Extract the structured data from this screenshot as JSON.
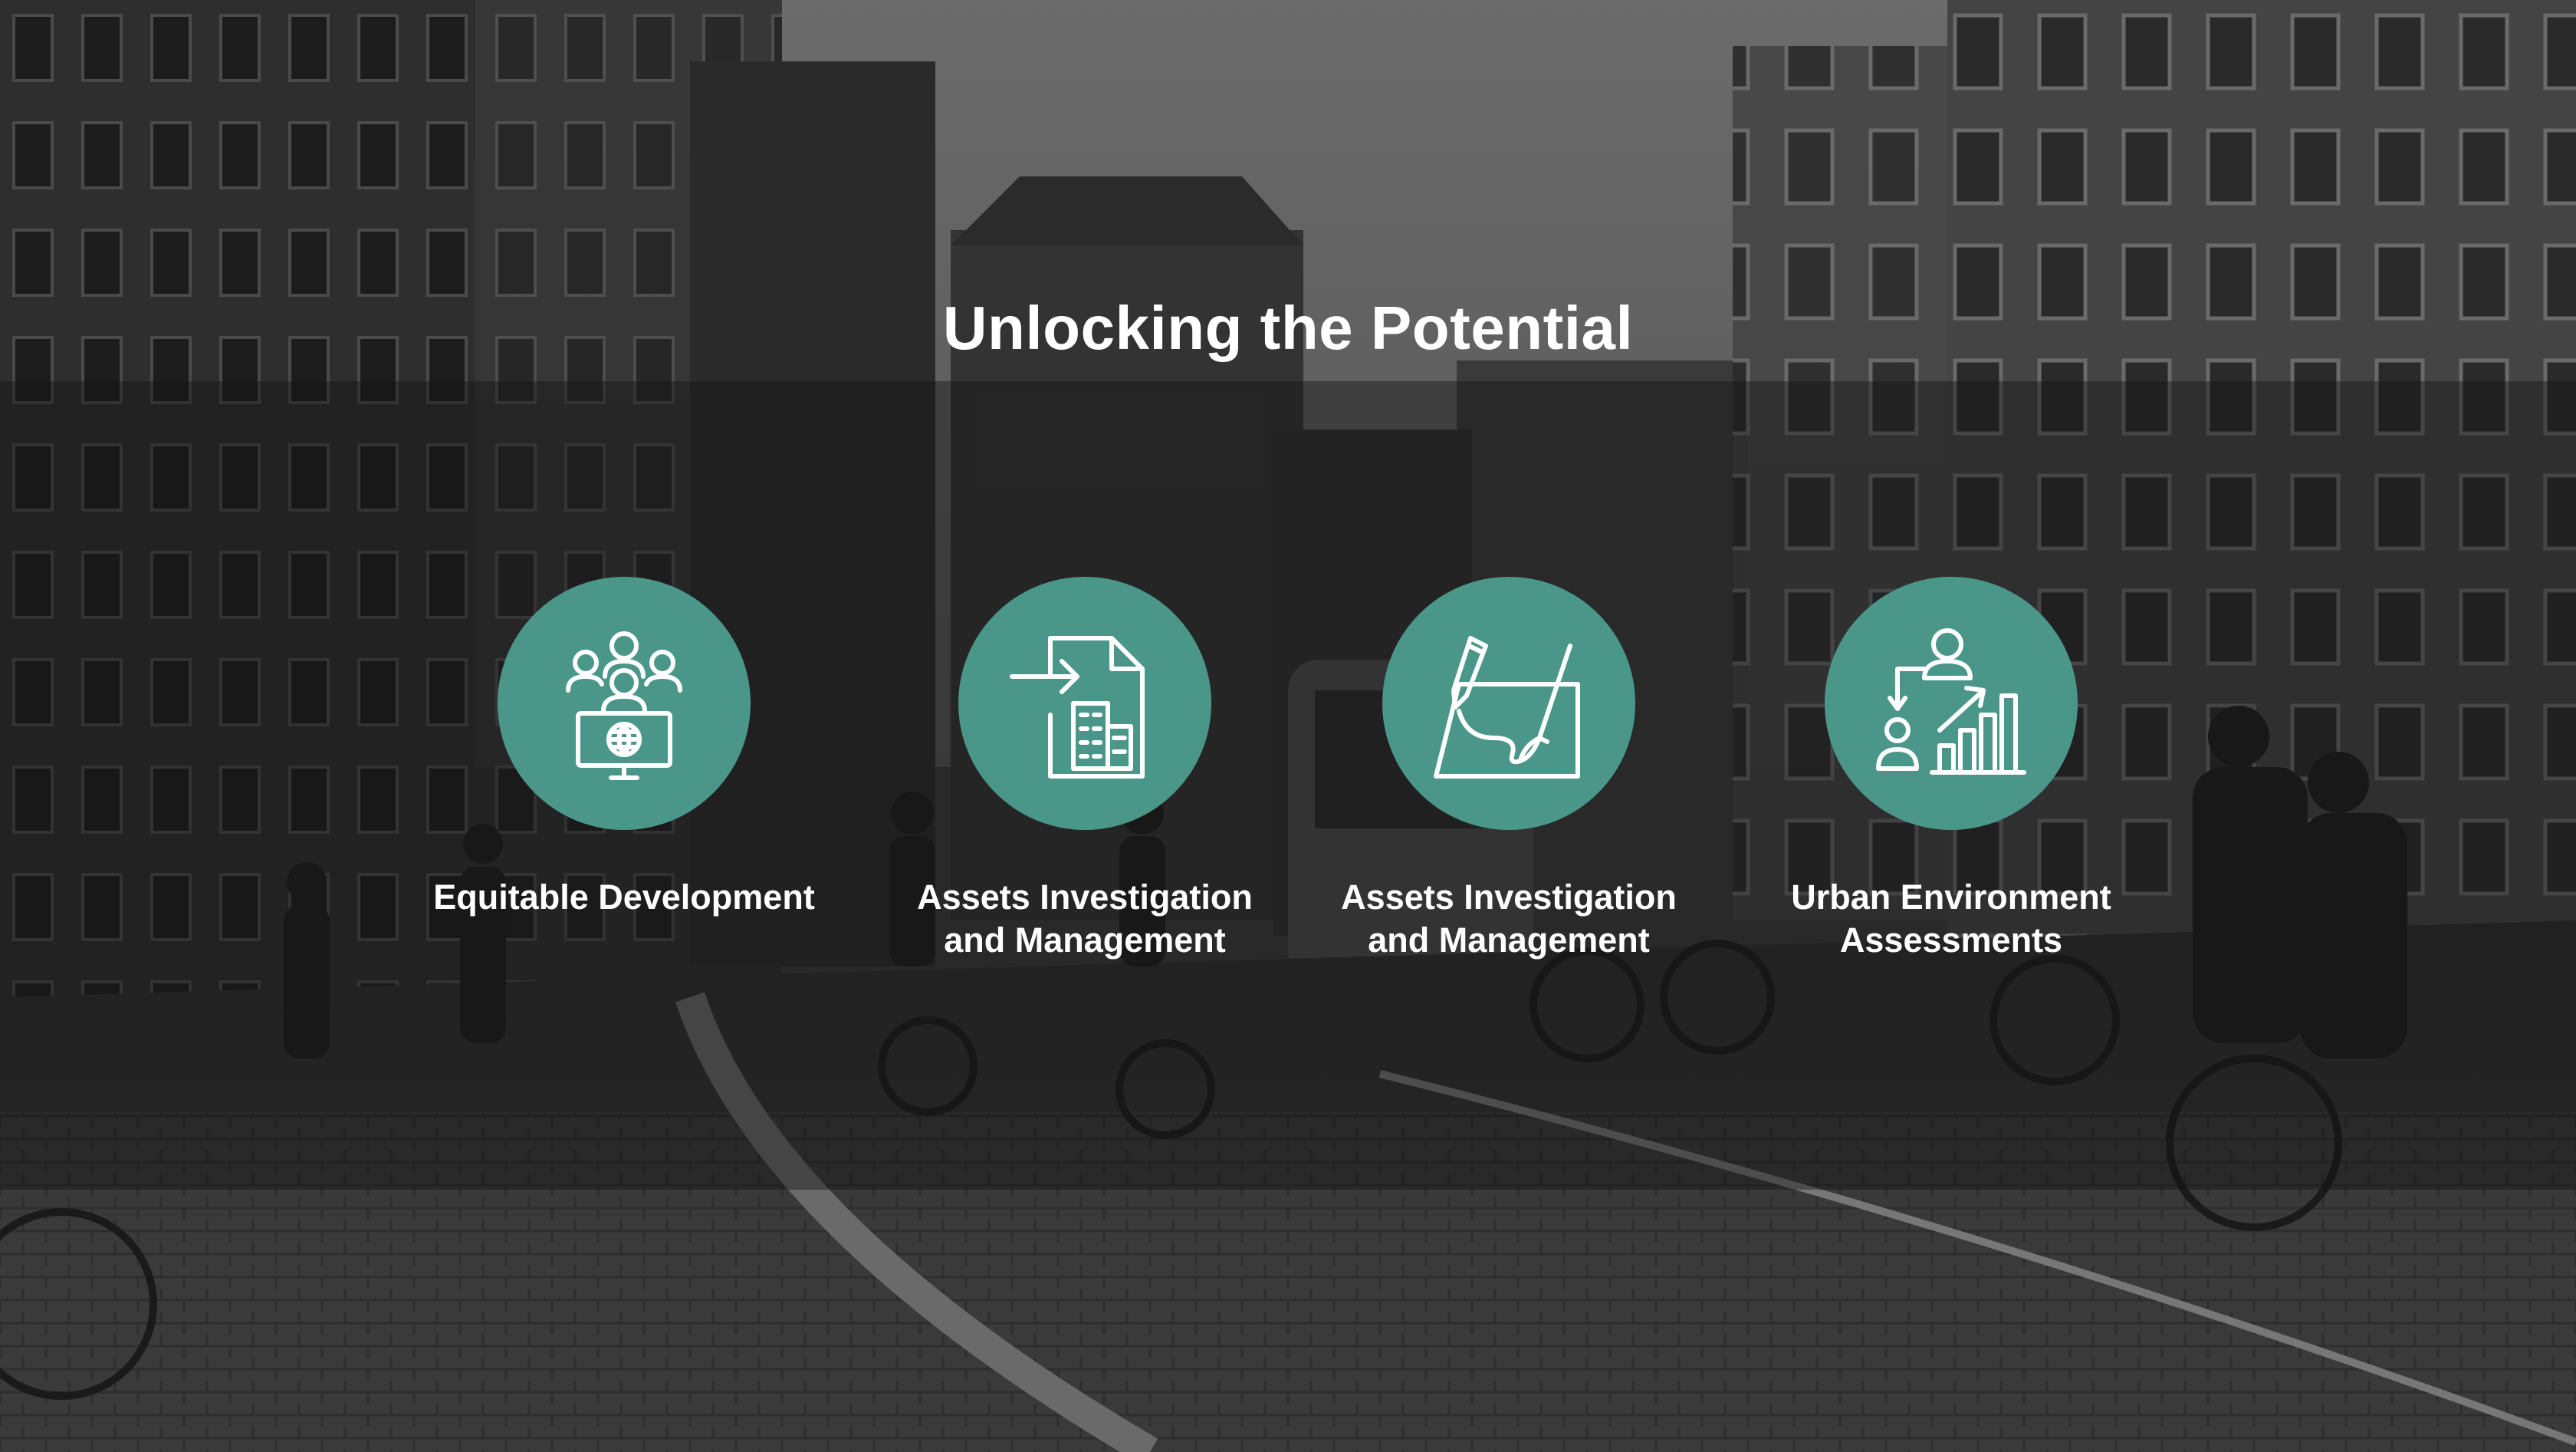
{
  "slide": {
    "title": "Unlocking the Potential",
    "background": "grayscale-city-street-photo"
  },
  "colors": {
    "accent": "#4a978a",
    "text": "#ffffff",
    "band_overlay": "#141414"
  },
  "items": [
    {
      "label": "Equitable Development",
      "icon": "community-globe-icon"
    },
    {
      "label": "Assets Investigation\nand Management",
      "icon": "document-building-icon"
    },
    {
      "label": "Assets Investigation\nand Management",
      "icon": "drawing-board-icon"
    },
    {
      "label": "Urban Environment\nAssessments",
      "icon": "people-growth-chart-icon"
    }
  ]
}
